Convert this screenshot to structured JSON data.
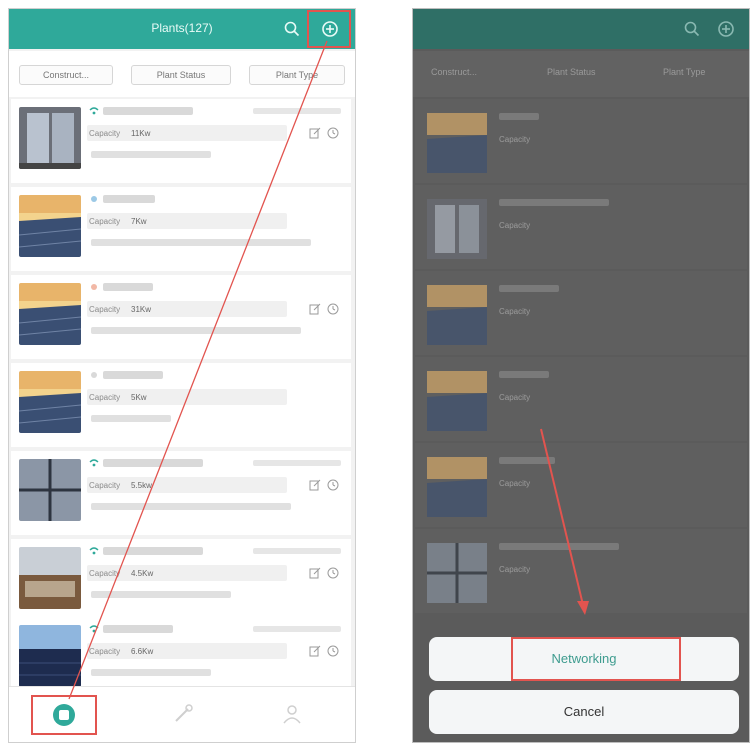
{
  "left": {
    "header": {
      "title": "Plants(127)"
    },
    "filters": [
      "Construct...",
      "Plant Status",
      "Plant Type"
    ],
    "capacity_label": "Capacity",
    "cards": [
      {
        "capacity": "11Kw",
        "thumb": "window"
      },
      {
        "capacity": "7Kw",
        "thumb": "sunset"
      },
      {
        "capacity": "31Kw",
        "thumb": "sunset"
      },
      {
        "capacity": "5Kw",
        "thumb": "sunset"
      },
      {
        "capacity": "5.5kw",
        "thumb": "grid"
      },
      {
        "capacity": "4.5Kw",
        "thumb": "roof"
      },
      {
        "capacity": "6.6Kw",
        "thumb": "dark"
      }
    ],
    "tabs": [
      "plants-tab",
      "tools-tab",
      "me-tab"
    ]
  },
  "right": {
    "sheet": {
      "networking": "Networking",
      "cancel": "Cancel"
    }
  }
}
